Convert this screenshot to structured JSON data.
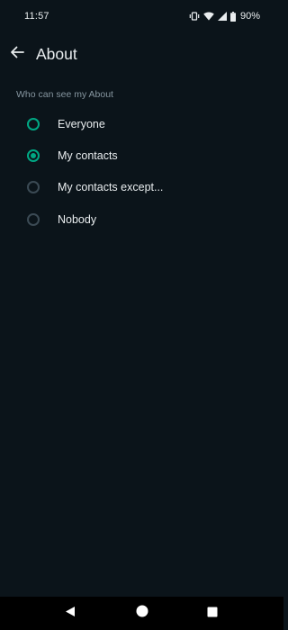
{
  "status_bar": {
    "time": "11:57",
    "battery": "90%",
    "icons": [
      "vibrate-icon",
      "wifi-icon",
      "signal-icon",
      "battery-icon"
    ]
  },
  "app_bar": {
    "title": "About",
    "back_icon": "back-arrow-icon"
  },
  "section": {
    "label": "Who can see my About"
  },
  "options": [
    {
      "label": "Everyone",
      "state": "unchecked-highlighted"
    },
    {
      "label": "My contacts",
      "state": "checked"
    },
    {
      "label": "My contacts except...",
      "state": "unchecked"
    },
    {
      "label": "Nobody",
      "state": "unchecked"
    }
  ],
  "nav_bar": {
    "icons": [
      "back-triangle-icon",
      "home-circle-icon",
      "recents-square-icon"
    ]
  },
  "colors": {
    "background": "#0b141a",
    "accent": "#00a884",
    "text_primary": "#e9edef",
    "text_secondary": "#8696a0",
    "radio_inactive": "#3b4a54"
  }
}
